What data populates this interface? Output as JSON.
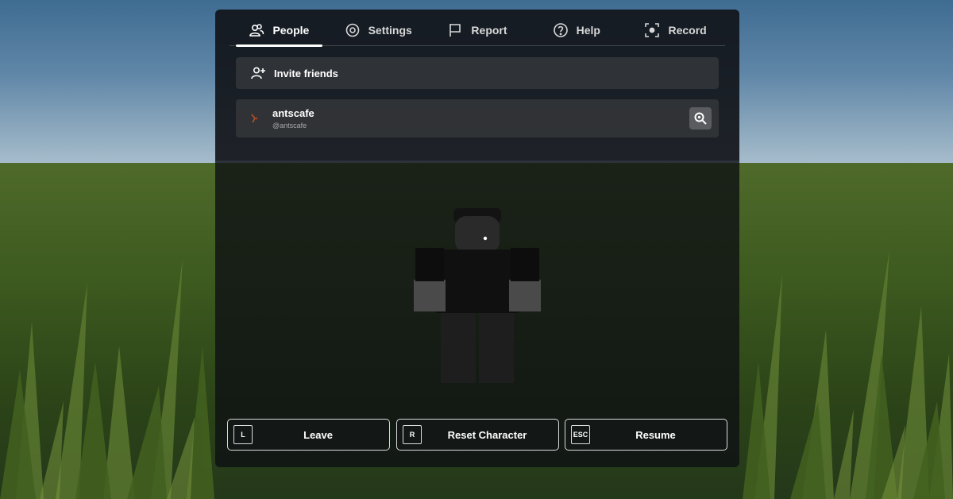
{
  "tabs": [
    {
      "label": "People",
      "icon": "people-icon",
      "active": true
    },
    {
      "label": "Settings",
      "icon": "settings-icon",
      "active": false
    },
    {
      "label": "Report",
      "icon": "flag-icon",
      "active": false
    },
    {
      "label": "Help",
      "icon": "help-icon",
      "active": false
    },
    {
      "label": "Record",
      "icon": "record-icon",
      "active": false
    }
  ],
  "invite": {
    "label": "Invite friends",
    "icon": "add-person-icon"
  },
  "player": {
    "display_name": "antscafe",
    "username": "@antscafe",
    "icon": "inspect-icon"
  },
  "bottom_buttons": [
    {
      "key": "L",
      "label": "Leave"
    },
    {
      "key": "R",
      "label": "Reset Character"
    },
    {
      "key": "ESC",
      "label": "Resume"
    }
  ],
  "colors": {
    "panel_bg": "#0e1014",
    "row_bg": "#34363a",
    "inspect_bg": "#5a5c60",
    "accent_white": "#ffffff"
  }
}
